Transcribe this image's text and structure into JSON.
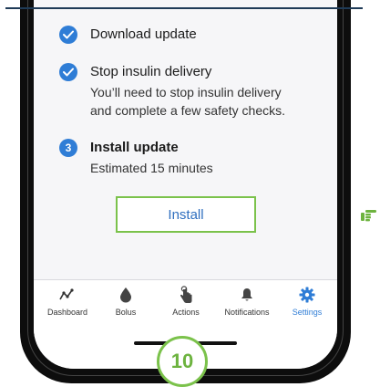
{
  "steps": [
    {
      "status": "done",
      "title": "Download update"
    },
    {
      "status": "done",
      "title": "Stop insulin delivery",
      "desc_line1": "You’ll need to stop insulin delivery",
      "desc_line2": "and complete a few safety checks."
    },
    {
      "status": "current",
      "number": "3",
      "title": "Install update",
      "desc_line1": "Estimated 15 minutes"
    }
  ],
  "install_button": {
    "label": "Install"
  },
  "tabs": [
    {
      "label": "Dashboard",
      "icon": "dashboard-trend-icon"
    },
    {
      "label": "Bolus",
      "icon": "drop-icon"
    },
    {
      "label": "Actions",
      "icon": "hand-tap-icon"
    },
    {
      "label": "Notifications",
      "icon": "bell-icon"
    },
    {
      "label": "Settings",
      "icon": "gear-icon",
      "active": true
    }
  ],
  "badge": {
    "number": "10"
  },
  "colors": {
    "accent_blue": "#2f7dd6",
    "highlight_green": "#7bc24b",
    "button_text": "#2f6fbf"
  }
}
